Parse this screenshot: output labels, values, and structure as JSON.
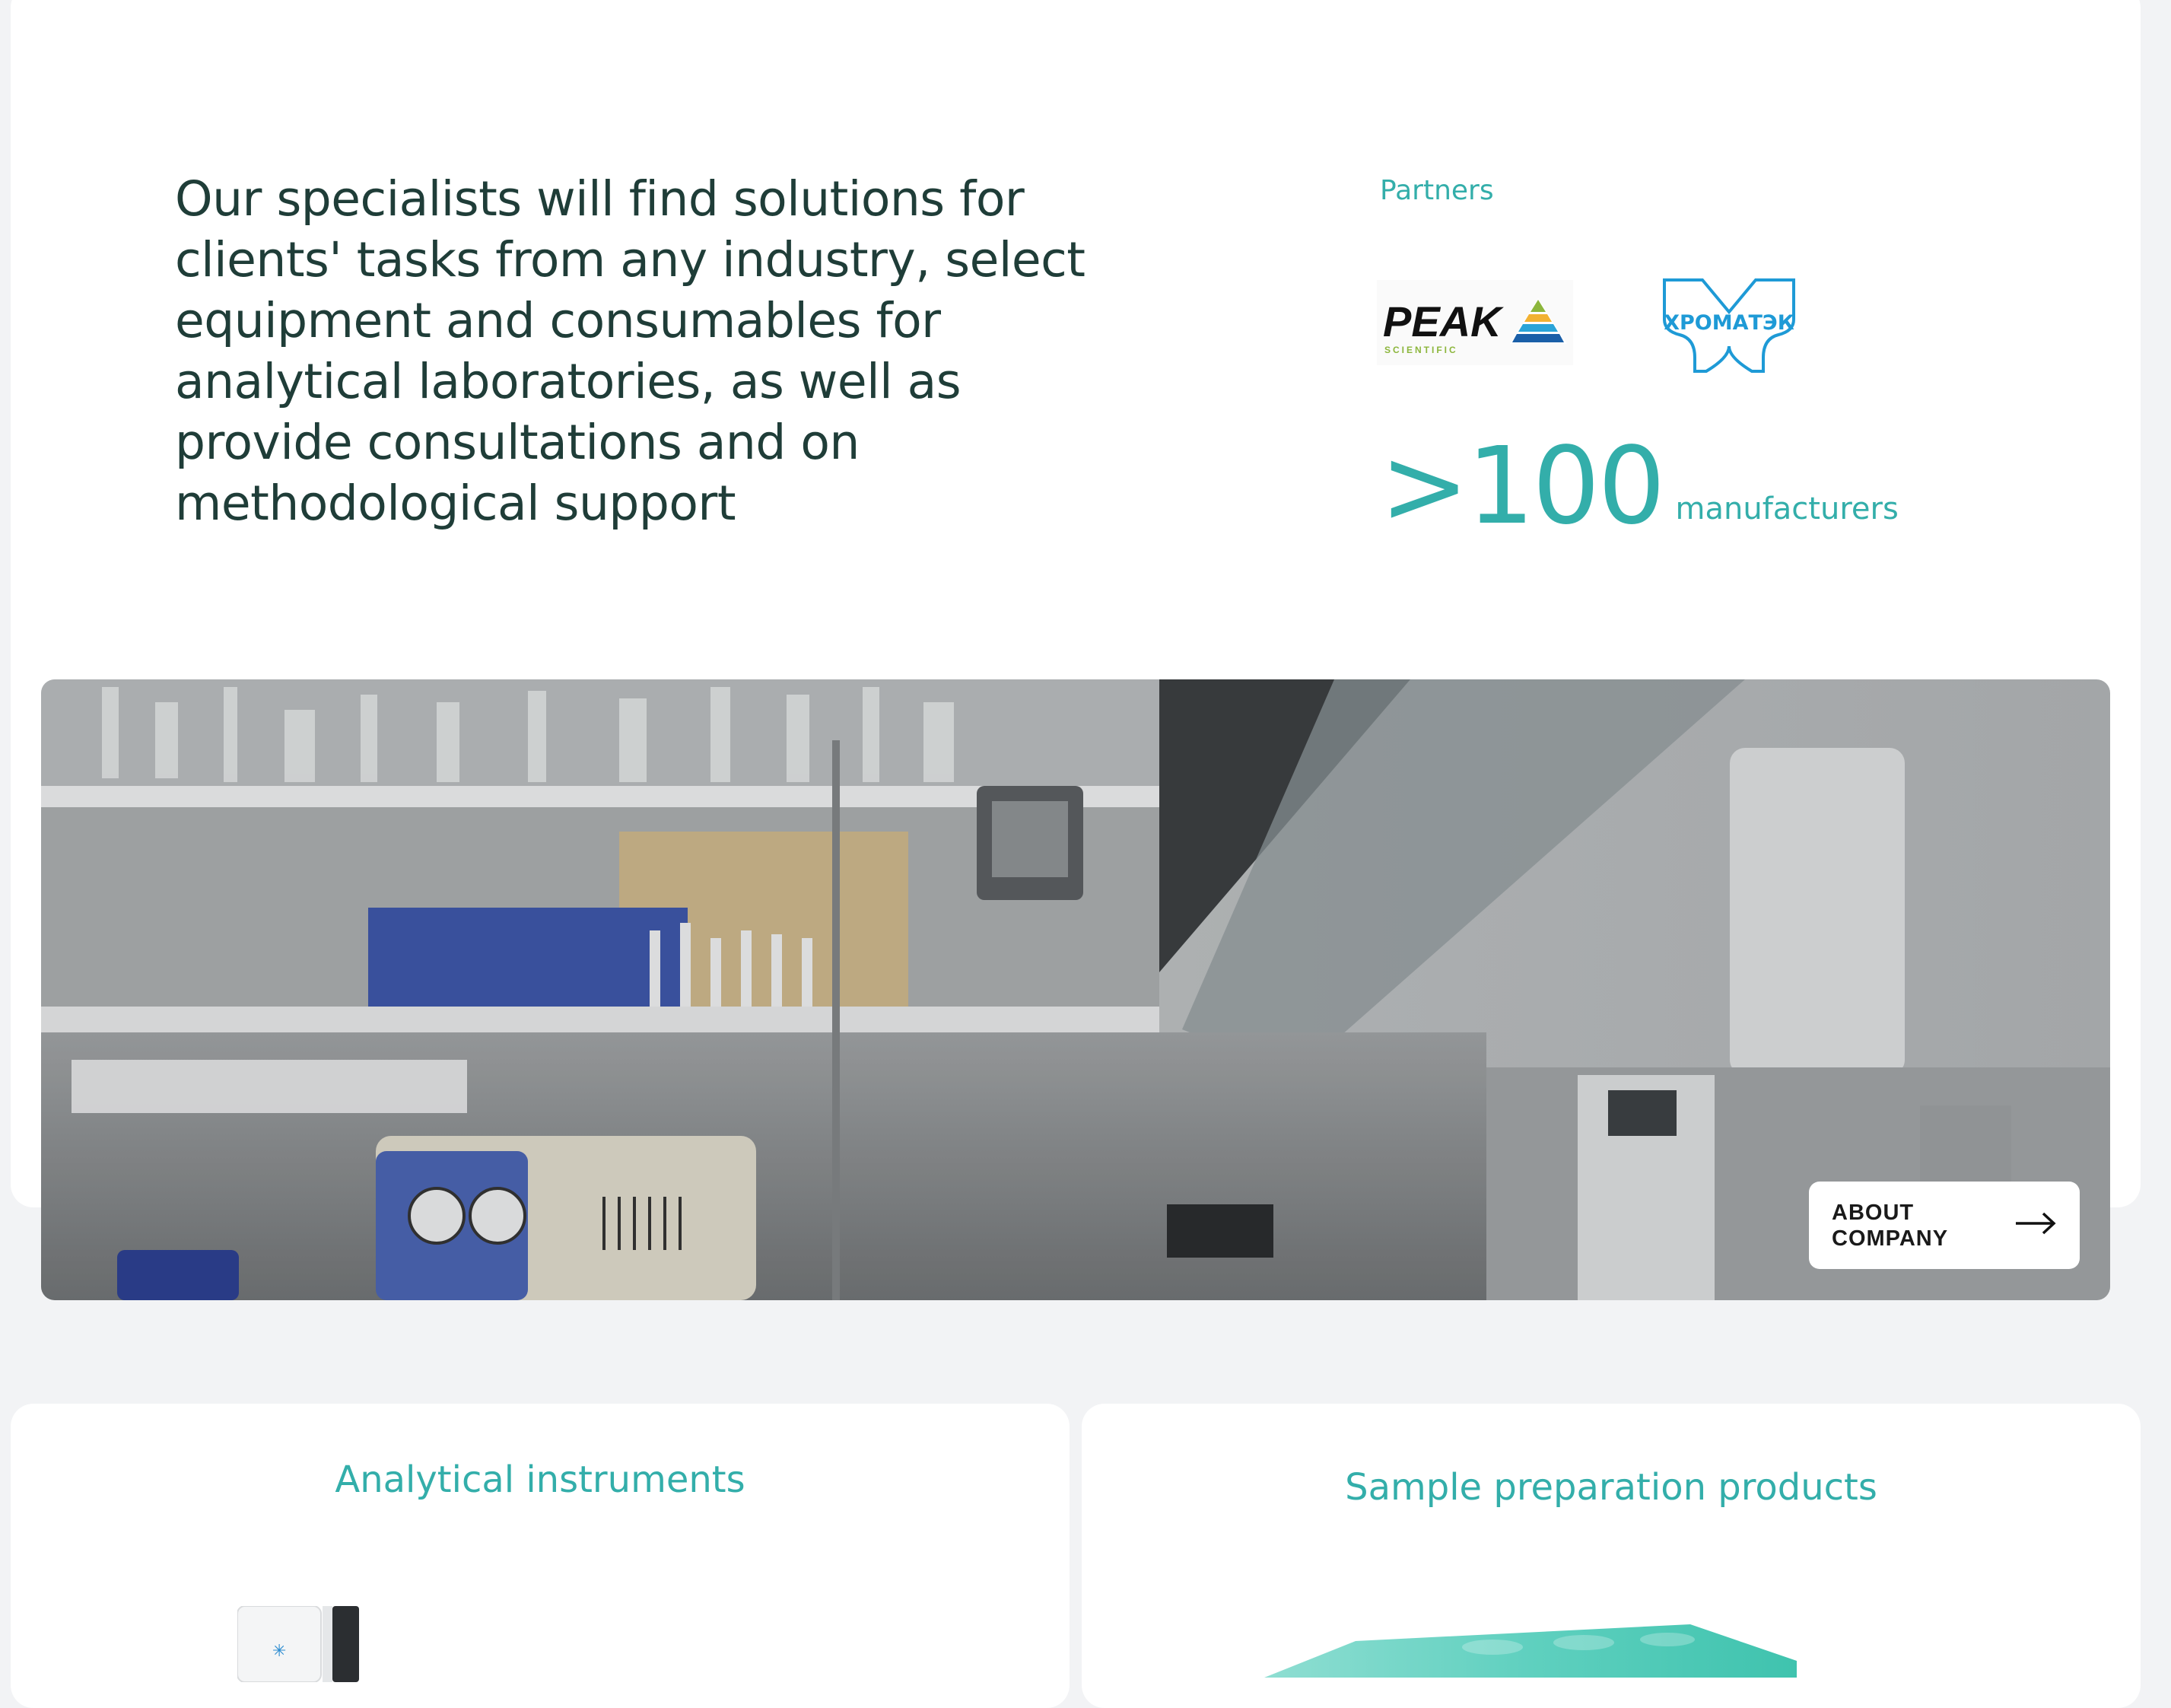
{
  "intro": {
    "text": "Our specialists will find solutions for clients' tasks from any industry, select equipment and consumables for analytical laboratories, as well as provide consultations and on methodological support"
  },
  "partners": {
    "label": "Partners",
    "logos": [
      {
        "name": "PEAK",
        "subtitle": "SCIENTIFIC",
        "icon": "peak-scientific-logo"
      },
      {
        "name": "ХРОМАТЭК",
        "icon": "chromatec-logo"
      }
    ]
  },
  "stat": {
    "value": ">100",
    "unit": "manufacturers"
  },
  "hero": {
    "image": "laboratory-photo",
    "button_label": "ABOUT COMPANY",
    "button_icon": "arrow-right-icon"
  },
  "categories": [
    {
      "title": "Analytical instruments",
      "image": "analytical-instrument-photo"
    },
    {
      "title": "Sample preparation products",
      "image": "sample-preparation-plate-photo"
    }
  ],
  "colors": {
    "accent": "#33aeaa",
    "heading_text": "#1f3d38",
    "page_bg": "#f2f3f5",
    "card_bg": "#ffffff"
  }
}
